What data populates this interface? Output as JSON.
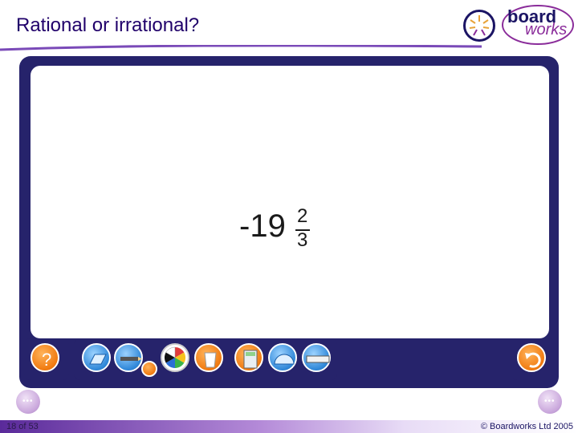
{
  "header": {
    "title": "Rational or irrational?"
  },
  "logo": {
    "line1": "board",
    "line2": "works"
  },
  "content": {
    "expression": {
      "sign_whole": "-19",
      "numerator": "2",
      "denominator": "3"
    }
  },
  "toolbar": {
    "left_tool_icon": "help-question-icon",
    "tools": [
      "parallelogram-icon",
      "pencil-icon",
      "color-wheel-icon",
      "trash-bin-icon",
      "calculator-icon",
      "protractor-icon",
      "ruler-icon"
    ],
    "right_tool_icon": "undo-arrow-icon"
  },
  "footer": {
    "slide_counter": "18 of 53",
    "copyright": "© Boardworks Ltd 2005"
  },
  "colors": {
    "frame": "#26236b",
    "accent_orange": "#f07a10",
    "accent_blue": "#2f87d8",
    "title": "#20006a"
  }
}
